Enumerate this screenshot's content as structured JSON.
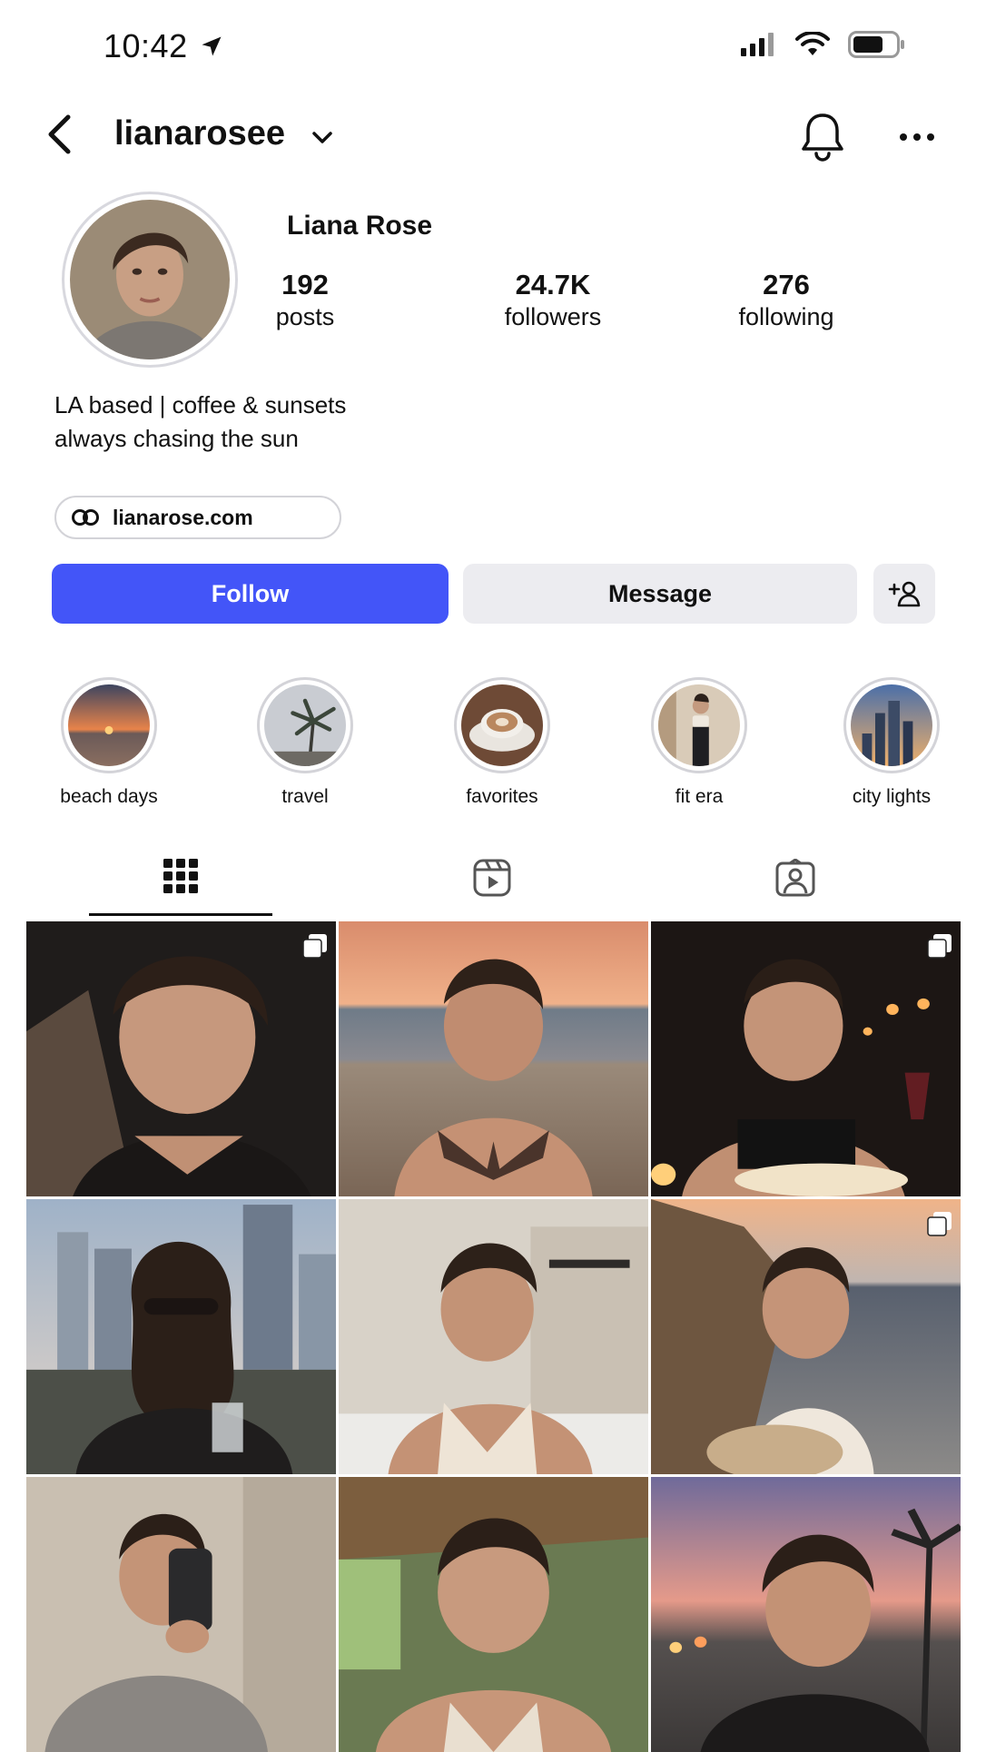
{
  "status_bar": {
    "time": "10:42"
  },
  "header": {
    "username": "lianarosee"
  },
  "profile": {
    "display_name": "Liana Rose",
    "stats": [
      {
        "value": "192",
        "label": "posts"
      },
      {
        "value": "24.7K",
        "label": "followers"
      },
      {
        "value": "276",
        "label": "following"
      }
    ],
    "bio": [
      "LA based | coffee & sunsets",
      "always chasing the sun"
    ],
    "link": "lianarose.com"
  },
  "actions": {
    "follow": "Follow",
    "message": "Message"
  },
  "highlights": [
    {
      "label": "beach days"
    },
    {
      "label": "travel"
    },
    {
      "label": "favorites"
    },
    {
      "label": "fit era"
    },
    {
      "label": "city lights"
    }
  ],
  "tabs": [
    {
      "icon": "grid-icon"
    },
    {
      "icon": "reels-icon"
    },
    {
      "icon": "tagged-icon"
    }
  ],
  "colors": {
    "follow_button": "#4355f8",
    "secondary_button": "#ececf0"
  }
}
